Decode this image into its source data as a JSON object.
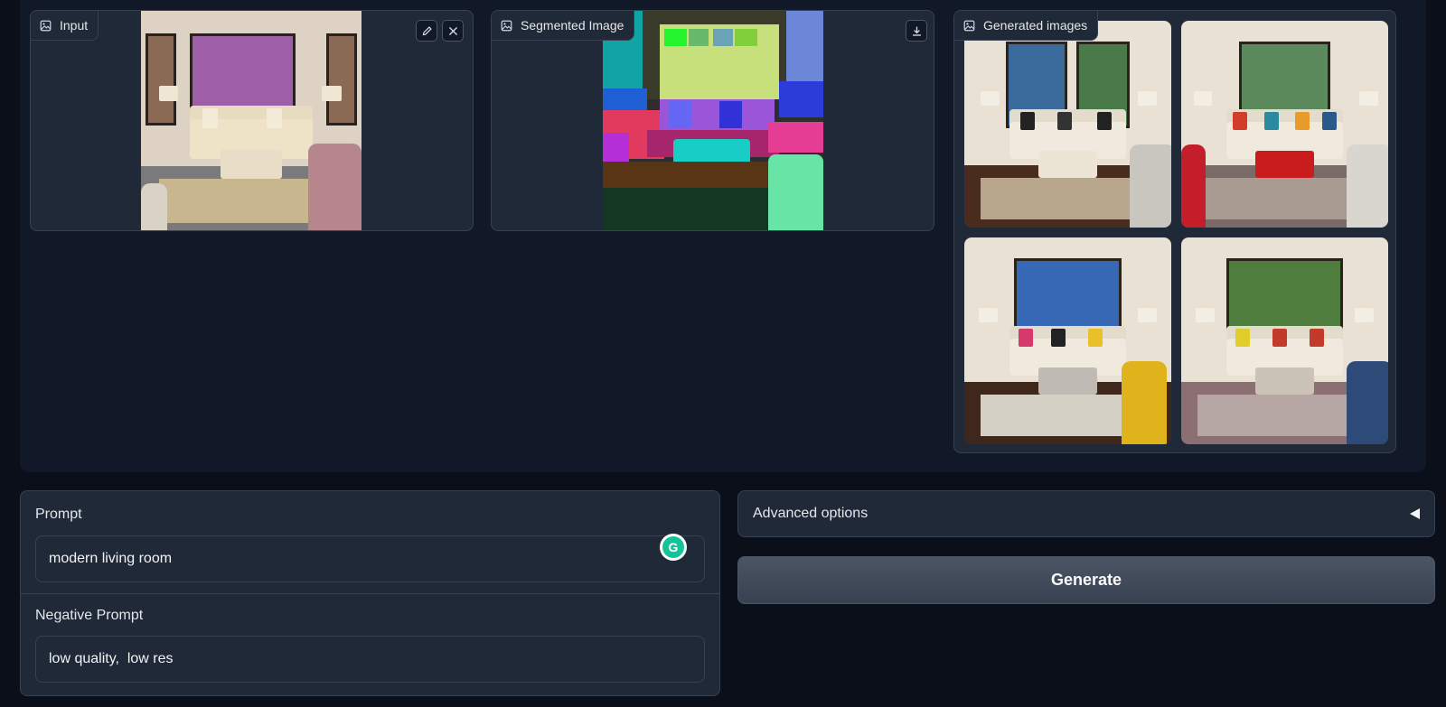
{
  "panels": {
    "input": {
      "label": "Input"
    },
    "segmented": {
      "label": "Segmented Image"
    },
    "generated": {
      "label": "Generated images"
    }
  },
  "prompt": {
    "label": "Prompt",
    "value": "modern living room"
  },
  "negative_prompt": {
    "label": "Negative Prompt",
    "value": "low quality,  low res"
  },
  "advanced_options": {
    "label": "Advanced options"
  },
  "generate_button": {
    "label": "Generate"
  },
  "grammarly": {
    "glyph": "G"
  },
  "icons": {
    "image": "image-icon",
    "edit": "pencil-icon",
    "clear": "close-icon",
    "download": "download-icon",
    "expand": "caret-left-icon"
  },
  "colors": {
    "background": "#0b0f19",
    "panel": "#1f2937",
    "border": "#374151",
    "grammarly": "#15c39a"
  }
}
